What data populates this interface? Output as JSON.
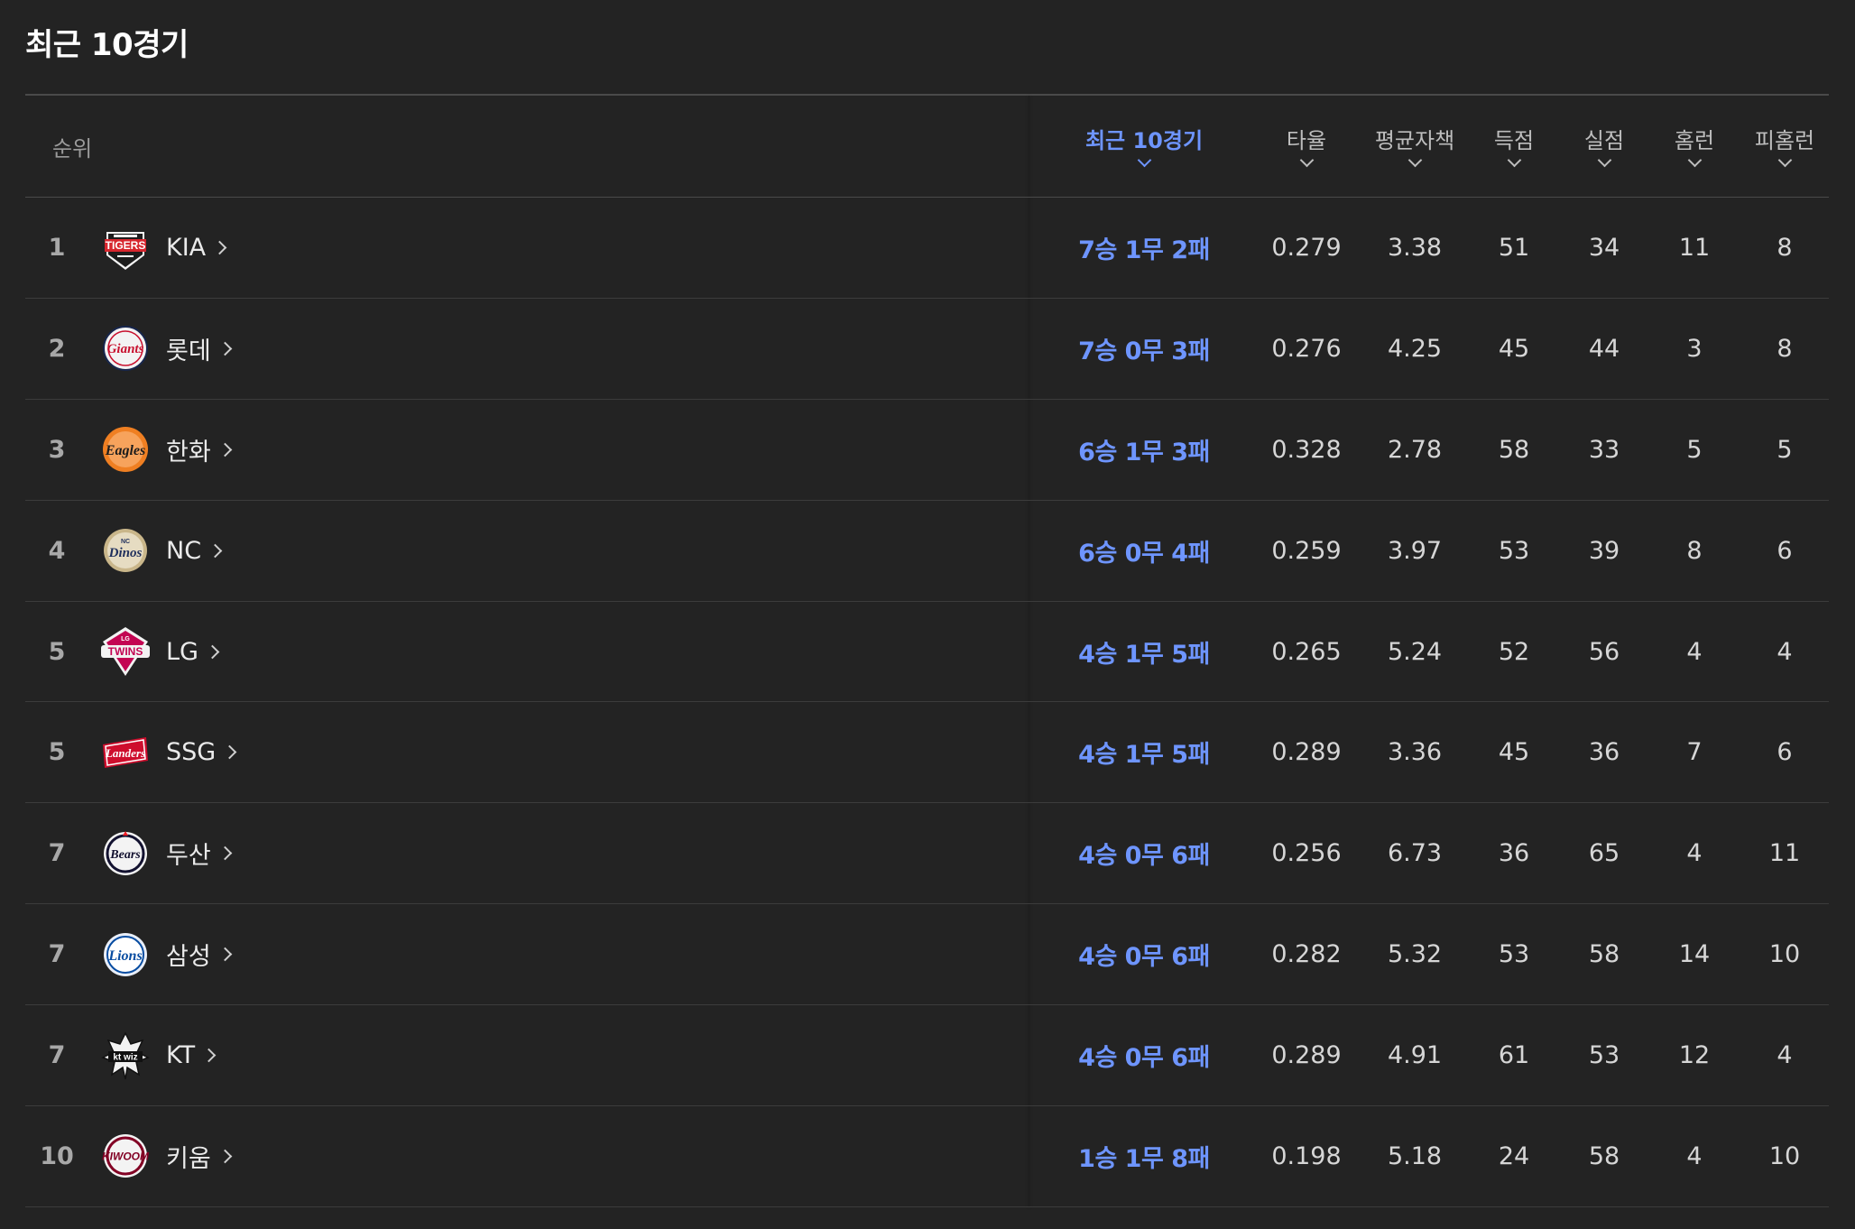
{
  "section": {
    "title": "최근 10경기"
  },
  "columns": {
    "rank": "순위",
    "recent": "최근 10경기",
    "avg": "타율",
    "era": "평균자책",
    "runs": "득점",
    "allowed": "실점",
    "hr": "홈런",
    "hr_allowed": "피홈런"
  },
  "colors": {
    "accent": "#6e95ff",
    "background": "#232323"
  },
  "rows": [
    {
      "rank": "1",
      "team": "KIA",
      "logo": "kia-tigers-logo",
      "recent": "7승 1무 2패",
      "avg": "0.279",
      "era": "3.38",
      "runs": "51",
      "allowed": "34",
      "hr": "11",
      "hr_allowed": "8"
    },
    {
      "rank": "2",
      "team": "롯데",
      "logo": "lotte-giants-logo",
      "recent": "7승 0무 3패",
      "avg": "0.276",
      "era": "4.25",
      "runs": "45",
      "allowed": "44",
      "hr": "3",
      "hr_allowed": "8"
    },
    {
      "rank": "3",
      "team": "한화",
      "logo": "hanwha-eagles-logo",
      "recent": "6승 1무 3패",
      "avg": "0.328",
      "era": "2.78",
      "runs": "58",
      "allowed": "33",
      "hr": "5",
      "hr_allowed": "5"
    },
    {
      "rank": "4",
      "team": "NC",
      "logo": "nc-dinos-logo",
      "recent": "6승 0무 4패",
      "avg": "0.259",
      "era": "3.97",
      "runs": "53",
      "allowed": "39",
      "hr": "8",
      "hr_allowed": "6"
    },
    {
      "rank": "5",
      "team": "LG",
      "logo": "lg-twins-logo",
      "recent": "4승 1무 5패",
      "avg": "0.265",
      "era": "5.24",
      "runs": "52",
      "allowed": "56",
      "hr": "4",
      "hr_allowed": "4"
    },
    {
      "rank": "5",
      "team": "SSG",
      "logo": "ssg-landers-logo",
      "recent": "4승 1무 5패",
      "avg": "0.289",
      "era": "3.36",
      "runs": "45",
      "allowed": "36",
      "hr": "7",
      "hr_allowed": "6"
    },
    {
      "rank": "7",
      "team": "두산",
      "logo": "doosan-bears-logo",
      "recent": "4승 0무 6패",
      "avg": "0.256",
      "era": "6.73",
      "runs": "36",
      "allowed": "65",
      "hr": "4",
      "hr_allowed": "11"
    },
    {
      "rank": "7",
      "team": "삼성",
      "logo": "samsung-lions-logo",
      "recent": "4승 0무 6패",
      "avg": "0.282",
      "era": "5.32",
      "runs": "53",
      "allowed": "58",
      "hr": "14",
      "hr_allowed": "10"
    },
    {
      "rank": "7",
      "team": "KT",
      "logo": "kt-wiz-logo",
      "recent": "4승 0무 6패",
      "avg": "0.289",
      "era": "4.91",
      "runs": "61",
      "allowed": "53",
      "hr": "12",
      "hr_allowed": "4"
    },
    {
      "rank": "10",
      "team": "키움",
      "logo": "kiwoom-heroes-logo",
      "recent": "1승 1무 8패",
      "avg": "0.198",
      "era": "5.18",
      "runs": "24",
      "allowed": "58",
      "hr": "4",
      "hr_allowed": "10"
    }
  ]
}
